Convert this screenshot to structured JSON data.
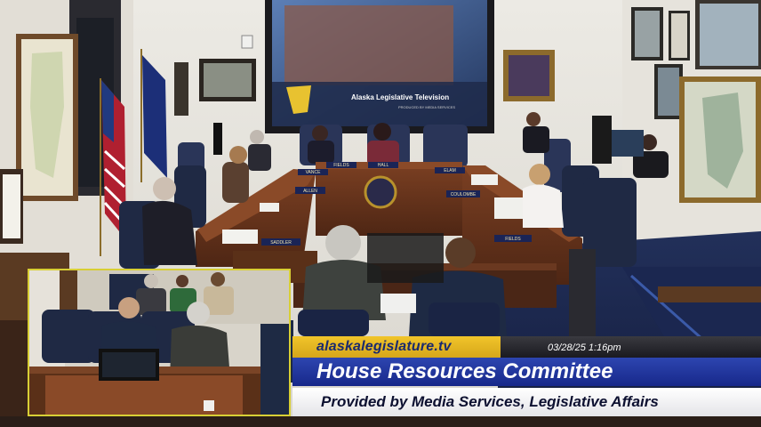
{
  "screen": {
    "title": "Alaska Legislative Television",
    "credit": "PRODUCED BY MEDIA SERVICES"
  },
  "nameplates": [
    "SADDLER",
    "ALLEN",
    "VANCE",
    "FIELDS",
    "COULOMBE",
    "HALL",
    "ELAM",
    "FIELDS"
  ],
  "lower_third": {
    "url": "alaskalegislature.tv",
    "datetime": "03/28/25  1:16pm",
    "committee": "House Resources Committee",
    "provider": "Provided by Media Services, Legislative Affairs"
  },
  "colors": {
    "url_bar": "#e2b524",
    "title_bar": "#1f35a0",
    "sub_bar": "#f2f2f4",
    "inset_border": "#d8cf35"
  }
}
